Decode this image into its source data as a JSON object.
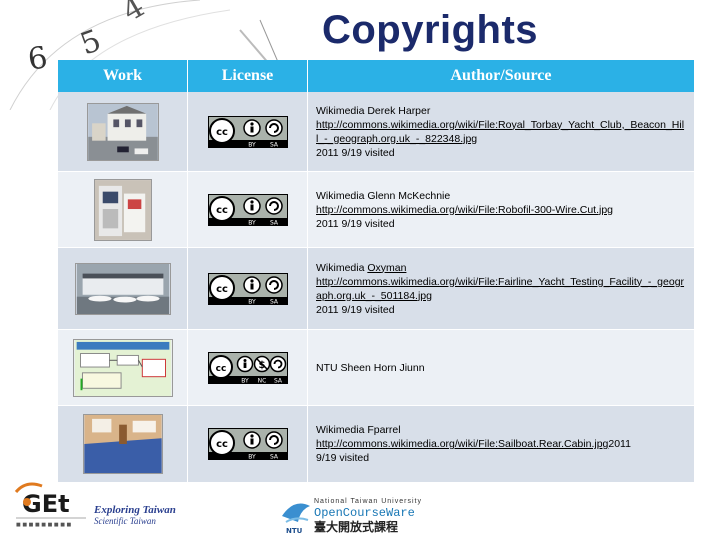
{
  "title": "Copyrights",
  "table": {
    "headers": [
      "Work",
      "License",
      "Author/Source"
    ],
    "rows": [
      {
        "license": "cc-by-sa",
        "author": "Wikimedia Derek Harper",
        "url": "http://commons.wikimedia.org/wiki/File:Royal_Torbay_Yacht_Club,_Beacon_Hill_-_geograph.org.uk_-_822348.jpg",
        "visited": "2011 9/19 visited"
      },
      {
        "license": "cc-by-sa",
        "author": "Wikimedia Glenn McKechnie",
        "url": "http://commons.wikimedia.org/wiki/File:Robofil-300-Wire.Cut.jpg",
        "visited": "2011 9/19 visited"
      },
      {
        "license": "cc-by-sa",
        "author_prefix": "Wikimedia ",
        "author_link": "Oxyman",
        "url": "http://commons.wikimedia.org/wiki/File:Fairline_Yacht_Testing_Facility_-_geograph.org.uk_-_501184.jpg",
        "visited": "2011 9/19 visited"
      },
      {
        "license": "cc-by-nc-sa",
        "author": "NTU Sheen Horn Jiunn"
      },
      {
        "license": "cc-by-sa",
        "author": "Wikimedia Fparrel",
        "url": "http://commons.wikimedia.org/wiki/File:Sailboat.Rear.Cabin.jpg",
        "visited_inline": "2011",
        "visited": "9/19 visited"
      }
    ]
  },
  "footer": {
    "get_logo": "GEt",
    "tagline1": "Exploring Taiwan",
    "tagline2": "Scientific Taiwan",
    "ntu_small": "National Taiwan University",
    "ntu_ocw": "OpenCourseWare",
    "ntu_cn": "臺大開放式課程",
    "ntu_abbr": "NTU"
  },
  "colors": {
    "header_bg": "#2bb1e6",
    "title": "#1b2a6b",
    "row_odd": "#d8dfe9",
    "row_even": "#ecf0f5"
  }
}
